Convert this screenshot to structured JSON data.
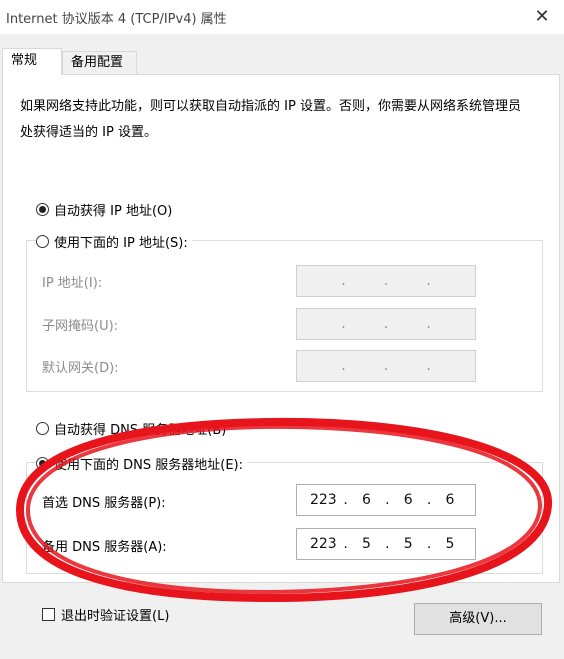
{
  "window": {
    "title": "Internet 协议版本 4 (TCP/IPv4) 属性",
    "close_icon": "close-icon"
  },
  "tabs": [
    {
      "label": "常规",
      "active": true
    },
    {
      "label": "备用配置",
      "active": false
    }
  ],
  "description": "如果网络支持此功能，则可以获取自动指派的 IP 设置。否则，你需要从网络系统管理员处获得适当的 IP 设置。",
  "ip_section": {
    "auto_option": {
      "label": "自动获得 IP 地址(O)",
      "selected": true
    },
    "manual_option": {
      "label": "使用下面的 IP 地址(S):",
      "selected": false
    },
    "fields": [
      {
        "label": "IP 地址(I):",
        "octets": [
          "",
          "",
          "",
          ""
        ]
      },
      {
        "label": "子网掩码(U):",
        "octets": [
          "",
          "",
          "",
          ""
        ]
      },
      {
        "label": "默认网关(D):",
        "octets": [
          "",
          "",
          "",
          ""
        ]
      }
    ]
  },
  "dns_section": {
    "auto_option": {
      "label": "自动获得 DNS 服务器地址(B)",
      "selected": false
    },
    "manual_option": {
      "label": "使用下面的 DNS 服务器地址(E):",
      "selected": true
    },
    "preferred": {
      "label": "首选 DNS 服务器(P):",
      "octets": [
        "223",
        "6",
        "6",
        "6"
      ]
    },
    "alternate": {
      "label": "备用 DNS 服务器(A):",
      "octets": [
        "223",
        "5",
        "5",
        "5"
      ]
    }
  },
  "validate_checkbox": {
    "label": "退出时验证设置(L)",
    "checked": false
  },
  "advanced_button": {
    "label": "高级(V)..."
  },
  "colors": {
    "annotation_red": "#e8141c",
    "dialog_bg": "#f0f0f0",
    "panel_bg": "#ffffff"
  }
}
